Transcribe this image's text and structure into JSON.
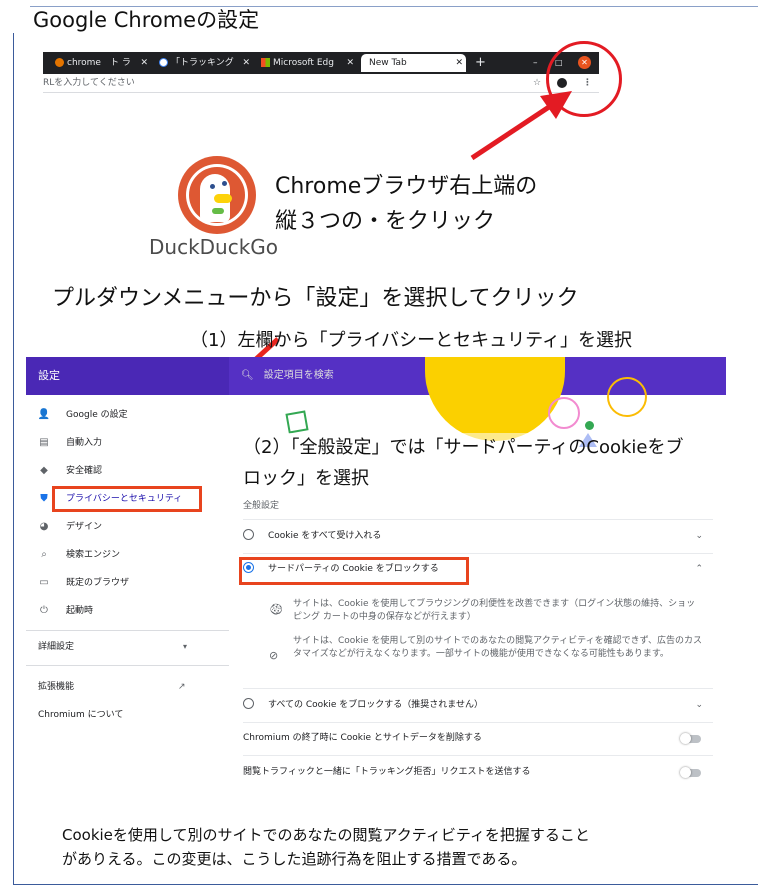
{
  "page": {
    "title": "Google Chromeの設定",
    "step1_text_line1": "Chromeブラウザ右上端の",
    "step1_text_line2": "縦３つの・をクリック",
    "step2_text": "プルダウンメニューから「設定」を選択してクリック",
    "step3_text": "（1）左欄から「プライバシーとセキュリティ」を選択",
    "step4_line1": "（2）「全般設定」では「サードパーティのCookieをブ",
    "step4_line2": "ロック」を選択",
    "footer_line1": "Cookieを使用して別のサイトでのあなたの閲覧アクティビティを把握すること",
    "footer_line2": "がありえる。この変更は、こうした追跡行為を阻止する措置である。"
  },
  "chrome": {
    "tabs": [
      {
        "label": "chrome　ト ラ",
        "icon": "chrome-page-icon",
        "color": "#e37400"
      },
      {
        "label": "「トラッキング",
        "icon": "google-icon",
        "color": "#ffffff"
      },
      {
        "label": "Microsoft Edg",
        "icon": "microsoft-icon",
        "color": "#f25022"
      },
      {
        "label": "New Tab",
        "icon": "",
        "color": ""
      }
    ],
    "new_tab_glyph": "+",
    "address_placeholder": "RLを入力してください",
    "brand_name": "DuckDuckGo",
    "colors": {
      "tabbar": "#202124",
      "close": "#e9541f",
      "annotation_red": "#e31b23"
    }
  },
  "settings": {
    "header_title": "設定",
    "search_placeholder": "設定項目を検索",
    "sidebar": [
      {
        "label": "Google の設定",
        "icon": "person-icon",
        "glyph": "👤"
      },
      {
        "label": "自動入力",
        "icon": "clipboard-icon",
        "glyph": "▤"
      },
      {
        "label": "安全確認",
        "icon": "shield-check-icon",
        "glyph": "◆"
      },
      {
        "label": "プライバシーとセキュリティ",
        "icon": "shield-lock-icon",
        "glyph": "⛊"
      },
      {
        "label": "デザイン",
        "icon": "palette-icon",
        "glyph": "◕"
      },
      {
        "label": "検索エンジン",
        "icon": "search-icon",
        "glyph": "⌕"
      },
      {
        "label": "既定のブラウザ",
        "icon": "browser-icon",
        "glyph": "▭"
      },
      {
        "label": "起動時",
        "icon": "power-icon",
        "glyph": "⏻"
      }
    ],
    "advanced_label": "詳細設定",
    "extensions_label": "拡張機能",
    "about_label": "Chromium について",
    "section_label": "全般設定",
    "options": [
      {
        "label": "Cookie をすべて受け入れる",
        "selected": false,
        "expanded": false
      },
      {
        "label": "サードパーティの Cookie をブロックする",
        "selected": true,
        "expanded": true
      },
      {
        "label": "すべての Cookie をブロックする（推奨されません）",
        "selected": false,
        "expanded": false
      }
    ],
    "desc1": "サイトは、Cookie を使用してブラウジングの利便性を改善できます（ログイン状態の維持、ショッピング カートの中身の保存などが行えます）",
    "desc2": "サイトは、Cookie を使用して別のサイトでのあなたの閲覧アクティビティを確認できず、広告のカスタマイズなどが行えなくなります。一部サイトの機能が使用できなくなる可能性もあります。",
    "toggle1_label": "Chromium の終了時に Cookie とサイトデータを削除する",
    "toggle2_label": "閲覧トラフィックと一緒に「トラッキング拒否」リクエストを送信する",
    "colors": {
      "header": "#5530c4",
      "accent": "#1a73e8",
      "highlight_box": "#e8441e"
    }
  }
}
